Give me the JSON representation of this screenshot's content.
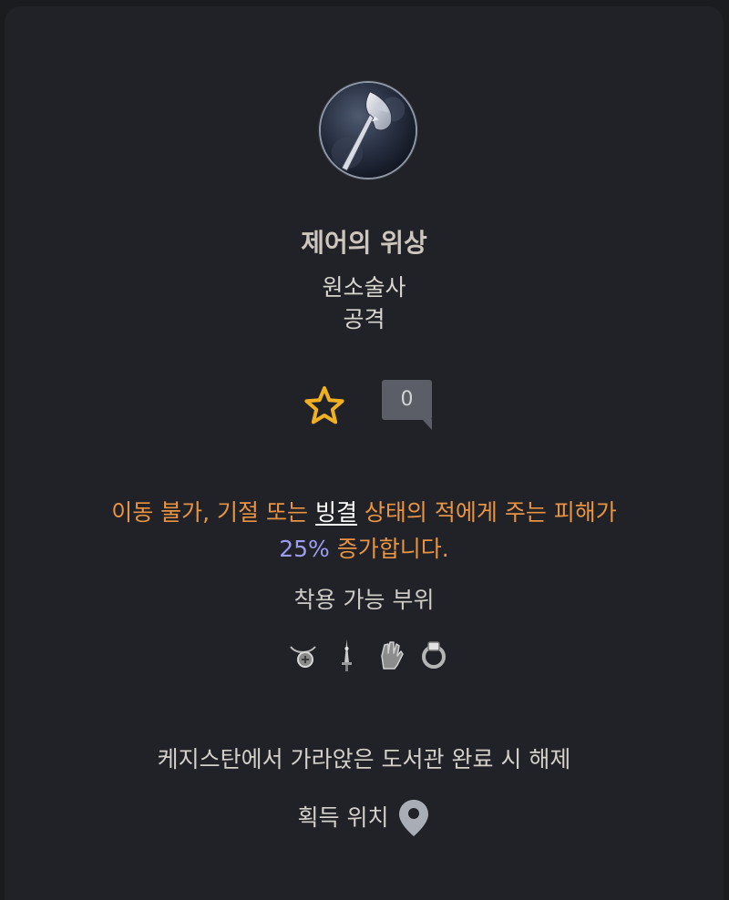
{
  "aspect": {
    "name": "제어의 위상",
    "class": "원소술사",
    "category": "공격",
    "icon": "axe-emblem-icon"
  },
  "actions": {
    "favorite_icon": "star-outline-icon",
    "comment_count": "0",
    "accent_color": "#f0b022"
  },
  "description": {
    "part1": "이동 불가, 기절 또는 ",
    "keyword": "빙결",
    "part2": " 상태의 적에게 주는 피해가",
    "value": "25%",
    "part3": " 증가합니다.",
    "text_color": "#e89443",
    "value_color": "#9d9cf1"
  },
  "slots": {
    "label": "착용 가능 부위",
    "items": [
      {
        "icon": "amulet-icon"
      },
      {
        "icon": "one-handed-weapon-icon"
      },
      {
        "icon": "gloves-icon"
      },
      {
        "icon": "ring-icon"
      }
    ]
  },
  "unlock": {
    "text": "케지스탄에서 가라앉은 도서관 완료 시 해제"
  },
  "location": {
    "label": "획득 위치",
    "icon": "map-pin-icon"
  }
}
